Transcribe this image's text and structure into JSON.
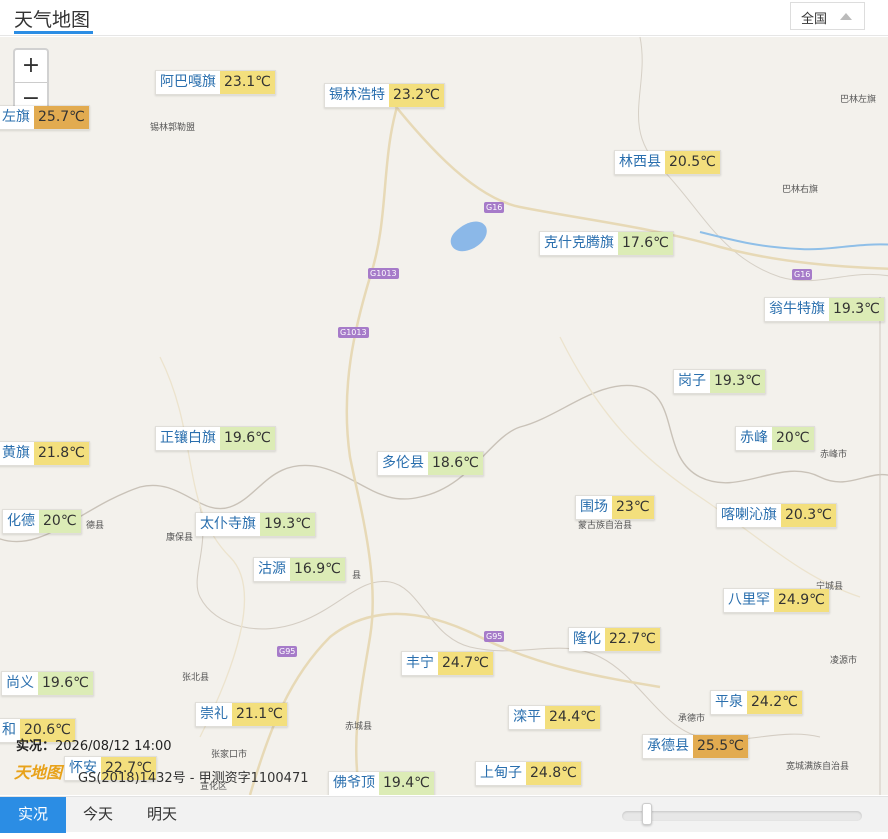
{
  "header": {
    "title": "天气地图",
    "region": "全国"
  },
  "zoom": {
    "in": "+",
    "out": "−"
  },
  "places": [
    {
      "id": "xilinguole",
      "name": "锡林郭勒盟"
    },
    {
      "id": "balinzuoqi",
      "name": "巴林左旗"
    },
    {
      "id": "balinyouqi",
      "name": "巴林右旗"
    },
    {
      "id": "kangbao",
      "name": "康保县"
    },
    {
      "id": "zhangbei",
      "name": "张北县"
    },
    {
      "id": "chicheng",
      "name": "赤城县"
    },
    {
      "id": "zhangjiakou",
      "name": "张家口市"
    },
    {
      "id": "xuanhua",
      "name": "宣化区"
    },
    {
      "id": "chengde",
      "name": "承德市"
    },
    {
      "id": "chifeng",
      "name": "赤峰市"
    },
    {
      "id": "ningcheng",
      "name": "宁城县"
    },
    {
      "id": "lingyuan",
      "name": "凌源市"
    },
    {
      "id": "weichang_full",
      "name": "蒙古族自治县"
    },
    {
      "id": "kuancheng",
      "name": "宽城满族自治县"
    },
    {
      "id": "huade_s",
      "name": "德县"
    },
    {
      "id": "guyuan_s",
      "name": "县"
    }
  ],
  "roads": [
    {
      "id": "g16a",
      "code": "G16"
    },
    {
      "id": "g16b",
      "code": "G16"
    },
    {
      "id": "g1013a",
      "code": "G1013"
    },
    {
      "id": "g1013b",
      "code": "G1013"
    },
    {
      "id": "g95a",
      "code": "G95"
    },
    {
      "id": "g95b",
      "code": "G95"
    }
  ],
  "stations": [
    {
      "id": "abagaqi",
      "name": "阿巴嘎旗",
      "temp": "23.1℃",
      "color": "#f3df7d"
    },
    {
      "id": "xilinhaote",
      "name": "锡林浩特",
      "temp": "23.2℃",
      "color": "#f3df7d"
    },
    {
      "id": "zuoqi",
      "name": "左旗",
      "temp": "25.7℃",
      "color": "#e2ab50"
    },
    {
      "id": "linxi",
      "name": "林西县",
      "temp": "20.5℃",
      "color": "#f3df7d"
    },
    {
      "id": "keshiketeng",
      "name": "克什克腾旗",
      "temp": "17.6℃",
      "color": "#dcecb6"
    },
    {
      "id": "wengniute",
      "name": "翁牛特旗",
      "temp": "19.3℃",
      "color": "#dcecb6"
    },
    {
      "id": "gangzi",
      "name": "岗子",
      "temp": "19.3℃",
      "color": "#dcecb6"
    },
    {
      "id": "chifeng",
      "name": "赤峰",
      "temp": "20℃",
      "color": "#dcecb6"
    },
    {
      "id": "huangqi",
      "name": "黄旗",
      "temp": "21.8℃",
      "color": "#f3df7d"
    },
    {
      "id": "zhengxiangbai",
      "name": "正镶白旗",
      "temp": "19.6℃",
      "color": "#dcecb6"
    },
    {
      "id": "duolun",
      "name": "多伦县",
      "temp": "18.6℃",
      "color": "#dcecb6"
    },
    {
      "id": "huade",
      "name": "化德",
      "temp": "20℃",
      "color": "#dcecb6"
    },
    {
      "id": "taipusi",
      "name": "太仆寺旗",
      "temp": "19.3℃",
      "color": "#dcecb6"
    },
    {
      "id": "weichang",
      "name": "围场",
      "temp": "23℃",
      "color": "#f3df7d"
    },
    {
      "id": "harqin",
      "name": "喀喇沁旗",
      "temp": "20.3℃",
      "color": "#f3df7d"
    },
    {
      "id": "guyuan",
      "name": "沽源",
      "temp": "16.9℃",
      "color": "#dcecb6"
    },
    {
      "id": "balihan",
      "name": "八里罕",
      "temp": "24.9℃",
      "color": "#f3df7d"
    },
    {
      "id": "longhua",
      "name": "隆化",
      "temp": "22.7℃",
      "color": "#f3df7d"
    },
    {
      "id": "fengning",
      "name": "丰宁",
      "temp": "24.7℃",
      "color": "#f3df7d"
    },
    {
      "id": "shangyi",
      "name": "尚义",
      "temp": "19.6℃",
      "color": "#dcecb6"
    },
    {
      "id": "pingquan",
      "name": "平泉",
      "temp": "24.2℃",
      "color": "#f3df7d"
    },
    {
      "id": "chongli",
      "name": "崇礼",
      "temp": "21.1℃",
      "color": "#f3df7d"
    },
    {
      "id": "luanping",
      "name": "滦平",
      "temp": "24.4℃",
      "color": "#f3df7d"
    },
    {
      "id": "he",
      "name": "和",
      "temp": "20.6℃",
      "color": "#f3df7d"
    },
    {
      "id": "chengdexian",
      "name": "承德县",
      "temp": "25.5℃",
      "color": "#e2ab50"
    },
    {
      "id": "huaian",
      "name": "怀安",
      "temp": "22.7℃",
      "color": "#f3df7d"
    },
    {
      "id": "shangdianzi",
      "name": "上甸子",
      "temp": "24.8℃",
      "color": "#f3df7d"
    },
    {
      "id": "foyeding",
      "name": "佛爷顶",
      "temp": "19.4℃",
      "color": "#dcecb6"
    }
  ],
  "info": {
    "observed_label": "实况：",
    "time": "2026/08/12 14:00",
    "logo": "天地图",
    "copyright": "GS(2018)1432号 - 甲测资字1100471"
  },
  "tabs": [
    {
      "id": "now",
      "label": "实况",
      "active": true
    },
    {
      "id": "today",
      "label": "今天",
      "active": false
    },
    {
      "id": "tomorrow",
      "label": "明天",
      "active": false
    }
  ],
  "colors": {
    "accent": "#2b8de4",
    "warm": "#f3df7d",
    "hot": "#e2ab50",
    "mild": "#dcecb6"
  }
}
